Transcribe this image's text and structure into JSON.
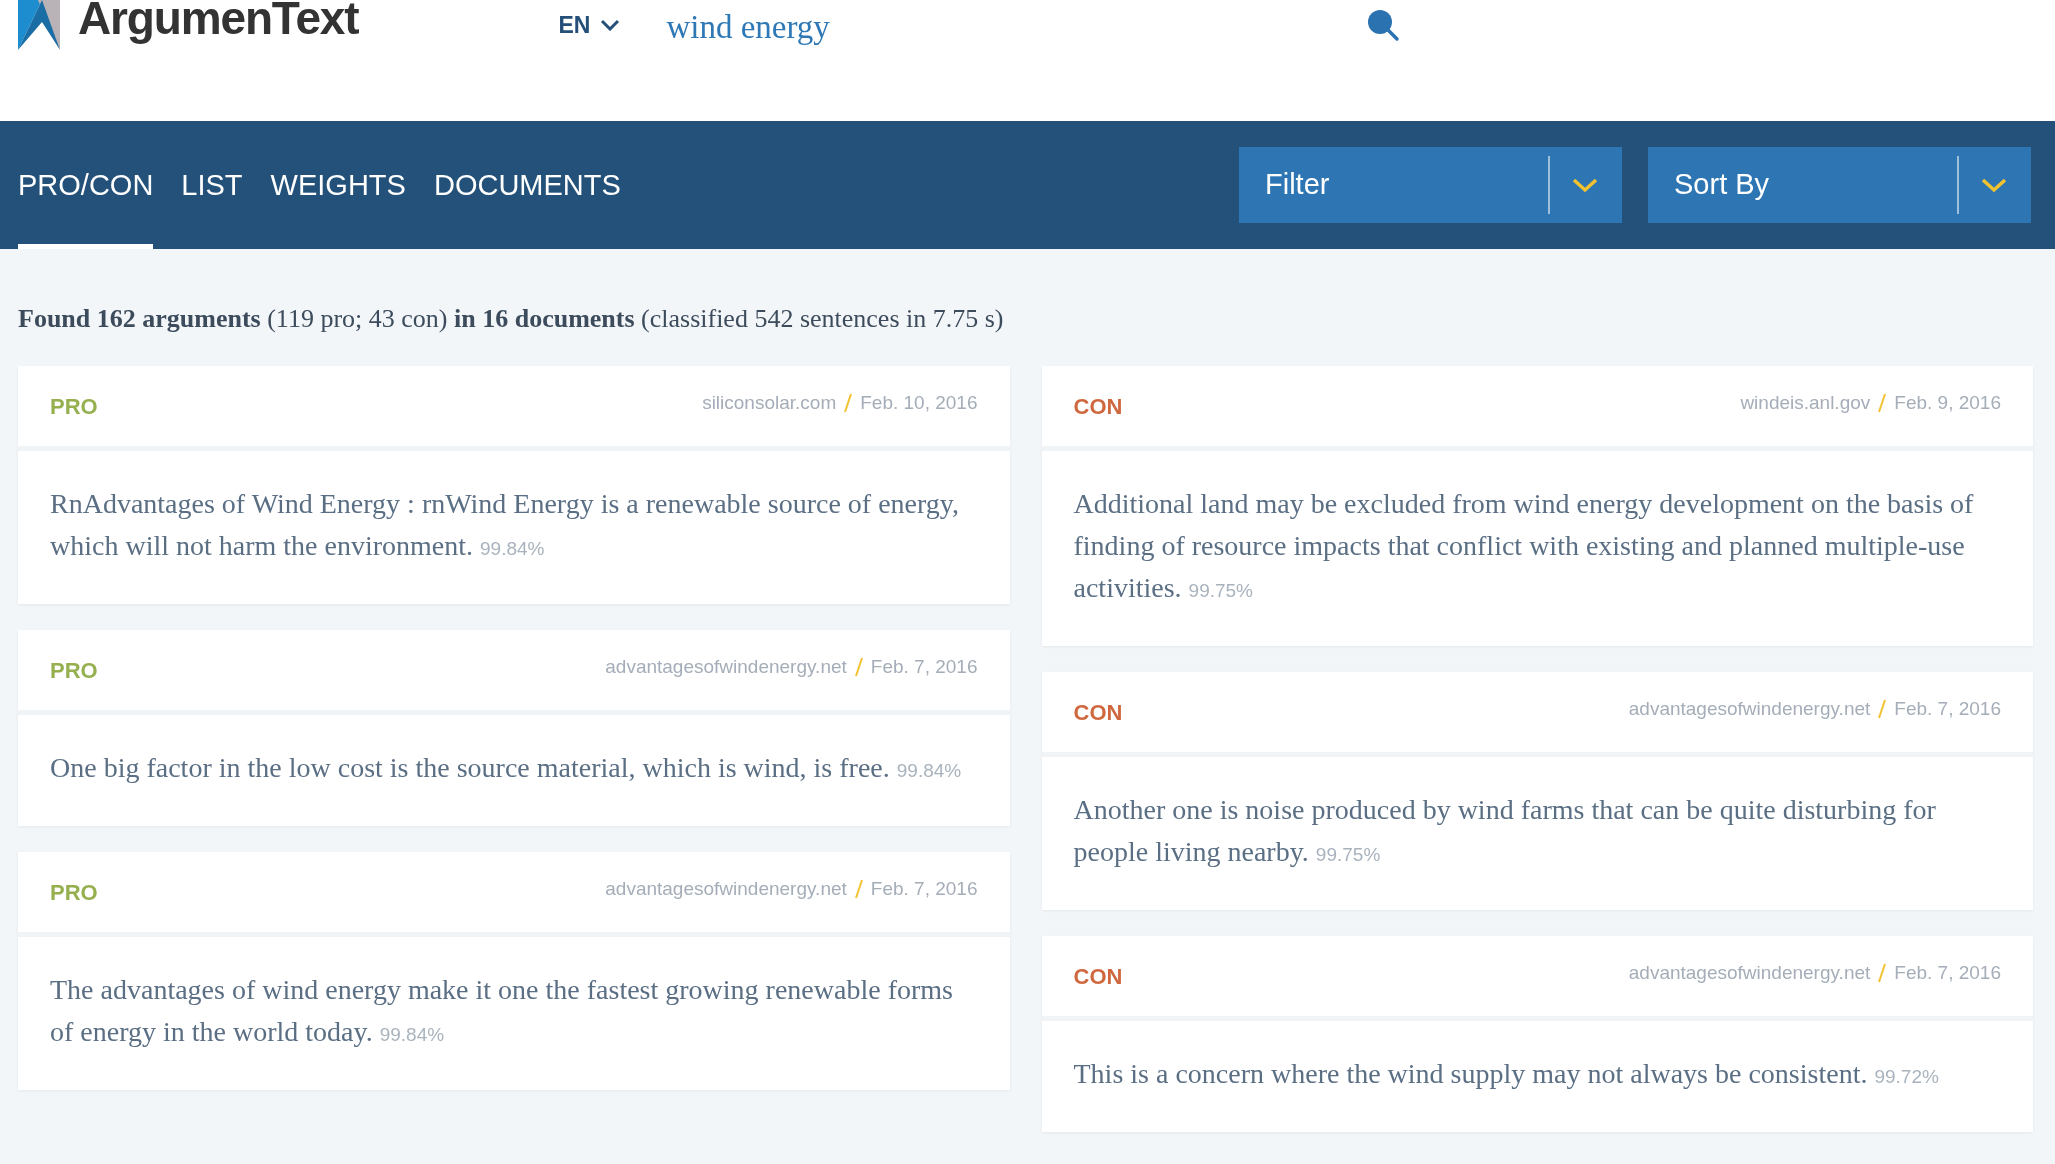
{
  "header": {
    "logo": "ArgumenText",
    "language": "EN",
    "query": "wind energy"
  },
  "tabs": [
    {
      "label": "PRO/CON",
      "selected": true
    },
    {
      "label": "LIST",
      "selected": false
    },
    {
      "label": "WEIGHTS",
      "selected": false
    },
    {
      "label": "DOCUMENTS",
      "selected": false
    }
  ],
  "dropdowns": [
    {
      "label": "Filter"
    },
    {
      "label": "Sort By"
    }
  ],
  "summary": "**Found 162 arguments** (119 pro; 43 con) **in 16 documents** (classified 542 sentences in 7.75 s)",
  "columns": [
    [
      {
        "kind": "pro",
        "label": "PRO",
        "source": "siliconsolar.com",
        "date": "Feb. 10, 2016",
        "text": "RnAdvantages of Wind Energy : rnWind Energy is a renewable source of energy, which will not harm the environment.",
        "score": "99.84%"
      },
      {
        "kind": "pro",
        "label": "PRO",
        "source": "advantagesofwindenergy.net",
        "date": "Feb. 7, 2016",
        "text": "One big factor in the low cost is the source material, which is wind, is free.",
        "score": "99.84%"
      },
      {
        "kind": "pro",
        "label": "PRO",
        "source": "advantagesofwindenergy.net",
        "date": "Feb. 7, 2016",
        "text": "The advantages of wind energy make it one the fastest growing renewable forms of energy in the world today.",
        "score": "99.84%"
      }
    ],
    [
      {
        "kind": "con",
        "label": "CON",
        "source": "windeis.anl.gov",
        "date": "Feb. 9, 2016",
        "text": "Additional land may be excluded from wind energy development on the basis of finding of resource impacts that conflict with existing and planned multiple-use activities.",
        "score": "99.75%"
      },
      {
        "kind": "con",
        "label": "CON",
        "source": "advantagesofwindenergy.net",
        "date": "Feb. 7, 2016",
        "text": "Another one is noise produced by wind farms that can be quite disturbing for people living nearby.",
        "score": "99.75%"
      },
      {
        "kind": "con",
        "label": "CON",
        "source": "advantagesofwindenergy.net",
        "date": "Feb. 7, 2016",
        "text": "This is a concern where the wind supply may not always be consistent.",
        "score": "99.72%"
      }
    ]
  ]
}
